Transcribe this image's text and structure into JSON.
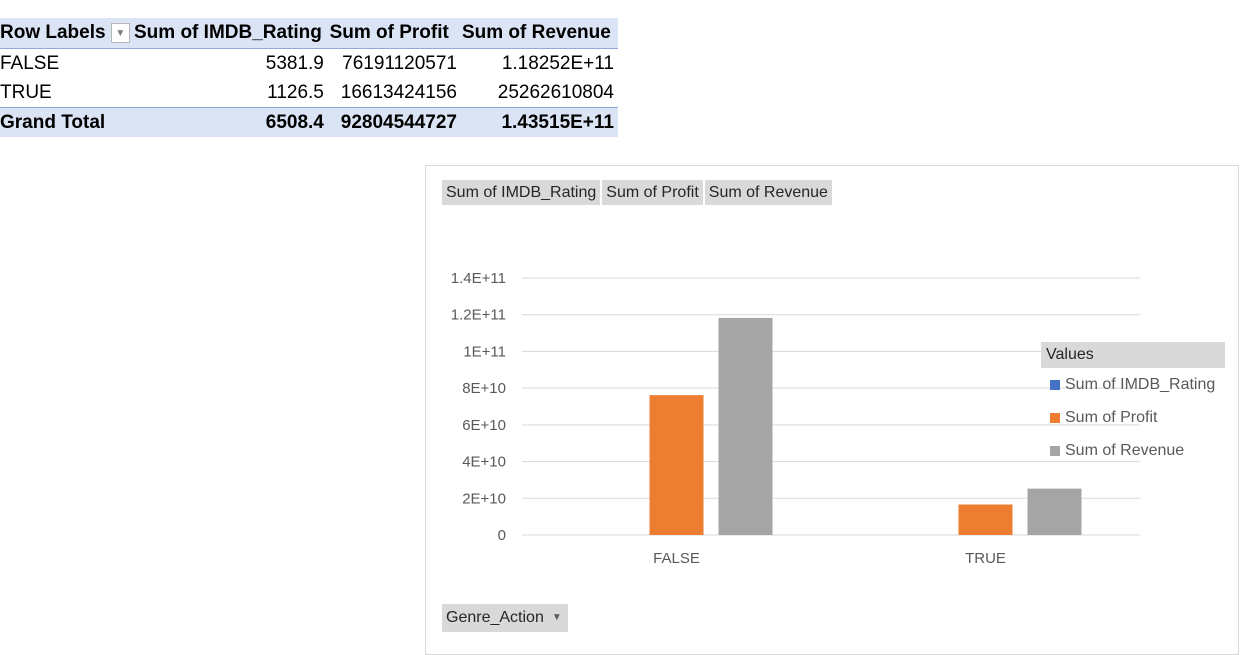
{
  "pivot": {
    "headers": {
      "row_labels": "Row Labels",
      "col1": "Sum of IMDB_Rating",
      "col2": "Sum of Profit",
      "col3": "Sum of Revenue"
    },
    "rows": [
      {
        "label": "FALSE",
        "rating": "5381.9",
        "profit": "76191120571",
        "revenue": "1.18252E+11"
      },
      {
        "label": "TRUE",
        "rating": "1126.5",
        "profit": "16613424156",
        "revenue": "25262610804"
      }
    ],
    "total": {
      "label": "Grand Total",
      "rating": "6508.4",
      "profit": "92804544727",
      "revenue": "1.43515E+11"
    },
    "filter_icon": "dropdown-arrow-icon"
  },
  "chart": {
    "field_buttons": [
      "Sum of IMDB_Rating",
      "Sum of Profit",
      "Sum of Revenue"
    ],
    "axis_field": "Genre_Action",
    "legend_title": "Values",
    "colors": {
      "rating": "#4472c4",
      "profit": "#ed7d31",
      "revenue": "#a5a5a5"
    }
  },
  "chart_data": {
    "type": "bar",
    "categories": [
      "FALSE",
      "TRUE"
    ],
    "series": [
      {
        "name": "Sum of IMDB_Rating",
        "values": [
          5381.9,
          1126.5
        ],
        "color": "#4472c4"
      },
      {
        "name": "Sum of Profit",
        "values": [
          76191120571,
          16613424156
        ],
        "color": "#ed7d31"
      },
      {
        "name": "Sum of Revenue",
        "values": [
          118252000000,
          25262610804
        ],
        "color": "#a5a5a5"
      }
    ],
    "ylim": [
      0,
      140000000000
    ],
    "yticks": [
      0,
      20000000000,
      40000000000,
      60000000000,
      80000000000,
      100000000000,
      120000000000,
      140000000000
    ],
    "ytick_labels": [
      "0",
      "2E+10",
      "4E+10",
      "6E+10",
      "8E+10",
      "1E+11",
      "1.2E+11",
      "1.4E+11"
    ],
    "grid": true,
    "legend_position": "right"
  }
}
